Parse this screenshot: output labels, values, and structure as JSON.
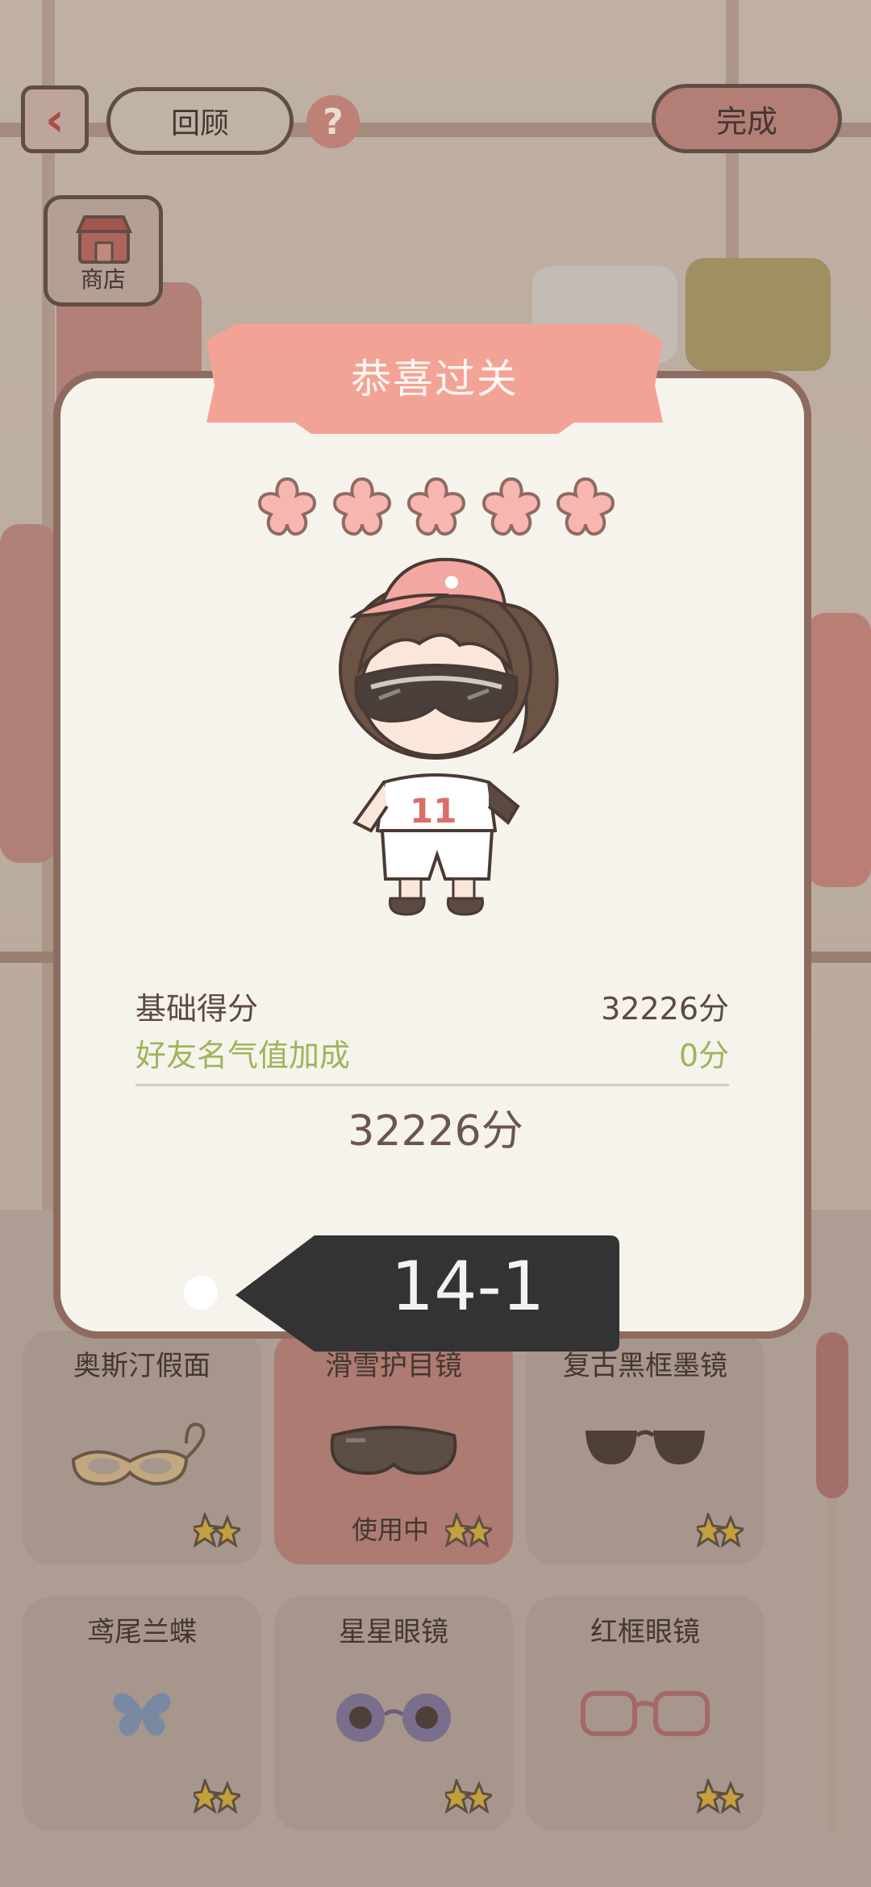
{
  "header": {
    "back_icon": "chevron-left-icon",
    "review_label": "回顾",
    "help_label": "?",
    "done_label": "完成",
    "shop_label": "商店"
  },
  "dialog": {
    "title": "恭喜过关",
    "stars_total": 5,
    "stars_filled": 5,
    "scores": {
      "base_label": "基础得分",
      "base_value": "32226分",
      "bonus_label": "好友名气值加成",
      "bonus_value": "0分",
      "total_value": "32226分"
    },
    "level": "14-1",
    "colors": {
      "title_banner": "#f3a396",
      "star": "#f7b7b0",
      "bonus_text": "#9fb45a",
      "level_tag": "#333333"
    }
  },
  "items": [
    {
      "name": "奥斯汀假面",
      "status": "",
      "icon": "masquerade-mask-icon"
    },
    {
      "name": "滑雪护目镜",
      "status": "使用中",
      "icon": "ski-goggles-icon",
      "active": true
    },
    {
      "name": "复古黑框墨镜",
      "status": "",
      "icon": "black-sunglasses-icon"
    },
    {
      "name": "鸢尾兰蝶",
      "status": "",
      "icon": "butterfly-icon"
    },
    {
      "name": "星星眼镜",
      "status": "",
      "icon": "flower-glasses-icon"
    },
    {
      "name": "红框眼镜",
      "status": "",
      "icon": "red-glasses-icon"
    }
  ]
}
